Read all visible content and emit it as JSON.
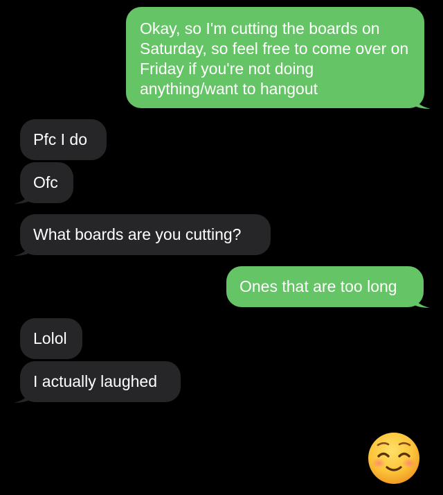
{
  "conversation": {
    "messages": [
      {
        "sender": "me",
        "text": "Okay, so I'm cutting the boards on Saturday, so feel free to come over on Friday if you're not doing anything/want to hangout"
      },
      {
        "sender": "them",
        "text": "Pfc I do"
      },
      {
        "sender": "them",
        "text": "Ofc"
      },
      {
        "sender": "them",
        "text": "What boards are you cutting?"
      },
      {
        "sender": "me",
        "text": "Ones that are too long"
      },
      {
        "sender": "them",
        "text": "Lolol"
      },
      {
        "sender": "them",
        "text": "I actually laughed"
      }
    ],
    "reaction_emoji": "smiling-face-with-smiling-eyes-icon"
  },
  "colors": {
    "background": "#000000",
    "sent_bubble": "#65c466",
    "received_bubble": "#262628",
    "text": "#ffffff"
  }
}
